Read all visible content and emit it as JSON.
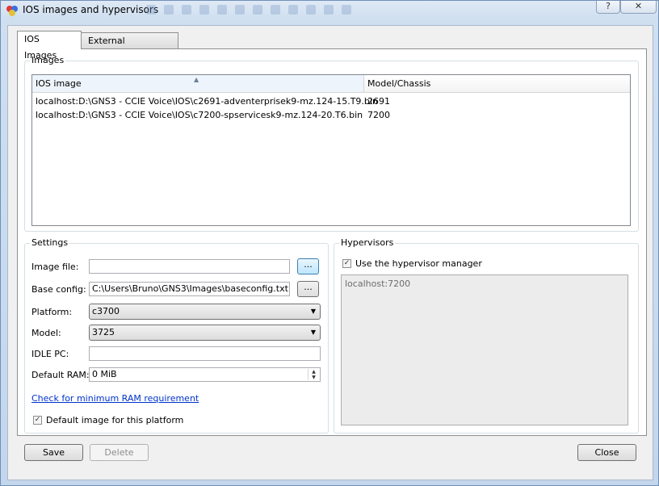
{
  "window": {
    "title": "IOS images and hypervisors",
    "help_label": "?",
    "close_label": "✕"
  },
  "tabs": [
    {
      "label": "IOS Images",
      "active": true
    },
    {
      "label": "External hypervisors",
      "active": false
    }
  ],
  "images": {
    "group_label": "Images",
    "columns": [
      "IOS image",
      "Model/Chassis"
    ],
    "rows": [
      {
        "image": "localhost:D:\\GNS3 - CCIE Voice\\IOS\\c2691-adventerprisek9-mz.124-15.T9.bin",
        "model": "2691"
      },
      {
        "image": "localhost:D:\\GNS3 - CCIE Voice\\IOS\\c7200-spservicesk9-mz.124-20.T6.bin",
        "model": "7200"
      }
    ]
  },
  "settings": {
    "group_label": "Settings",
    "image_file_label": "Image file:",
    "image_file_value": "",
    "browse_label": "...",
    "base_config_label": "Base config:",
    "base_config_value": "C:\\Users\\Bruno\\GNS3\\Images\\baseconfig.txt",
    "platform_label": "Platform:",
    "platform_value": "c3700",
    "model_label": "Model:",
    "model_value": "3725",
    "idle_pc_label": "IDLE PC:",
    "idle_pc_value": "",
    "default_ram_label": "Default RAM:",
    "default_ram_value": "0 MiB",
    "ram_link": "Check for minimum RAM requirement",
    "default_image_label": "Default image for this platform",
    "default_image_checked": true
  },
  "hypervisors": {
    "group_label": "Hypervisors",
    "use_manager_label": "Use the hypervisor manager",
    "use_manager_checked": true,
    "list": [
      "localhost:7200"
    ]
  },
  "buttons": {
    "save": "Save",
    "delete": "Delete",
    "close": "Close"
  },
  "colors": {
    "titlebar": "#cfdff0",
    "link": "#0033cc",
    "disabled_text": "#8d8d8d"
  }
}
